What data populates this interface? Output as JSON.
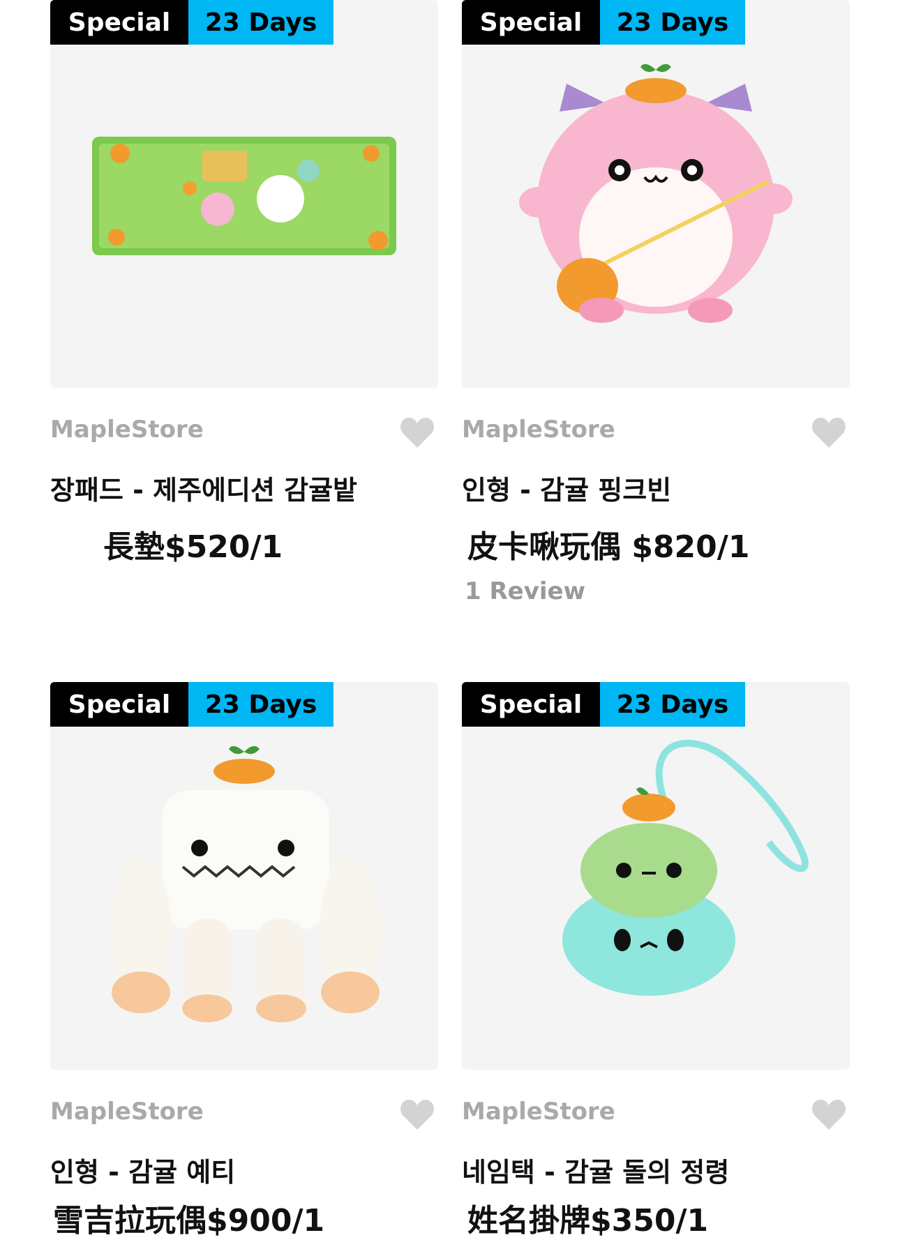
{
  "products": [
    {
      "badge_special": "Special",
      "badge_days": "23 Days",
      "store": "MapleStore",
      "title": "장패드 - 제주에디션 감귤밭",
      "price": "長墊$520/1",
      "image": "desk-mat-icon"
    },
    {
      "badge_special": "Special",
      "badge_days": "23 Days",
      "store": "MapleStore",
      "title": "인형 - 감귤 핑크빈",
      "price": "皮卡啾玩偶 $820/1",
      "review": "1 Review",
      "image": "pink-bean-plush-icon"
    },
    {
      "badge_special": "Special",
      "badge_days": "23 Days",
      "store": "MapleStore",
      "title": "인형 - 감귤 예티",
      "price": "雪吉拉玩偶$900/1",
      "image": "yeti-plush-icon"
    },
    {
      "badge_special": "Special",
      "badge_days": "23 Days",
      "store": "MapleStore",
      "title": "네임택 - 감귤 돌의 정령",
      "price": "姓名掛牌$350/1",
      "image": "name-tag-icon"
    }
  ],
  "colors": {
    "accent": "#00b6f3",
    "badge_dark": "#000000",
    "muted": "#a9a9a9",
    "thumb_bg": "#f4f4f4"
  },
  "icons": {
    "wishlist": "heart-icon"
  }
}
